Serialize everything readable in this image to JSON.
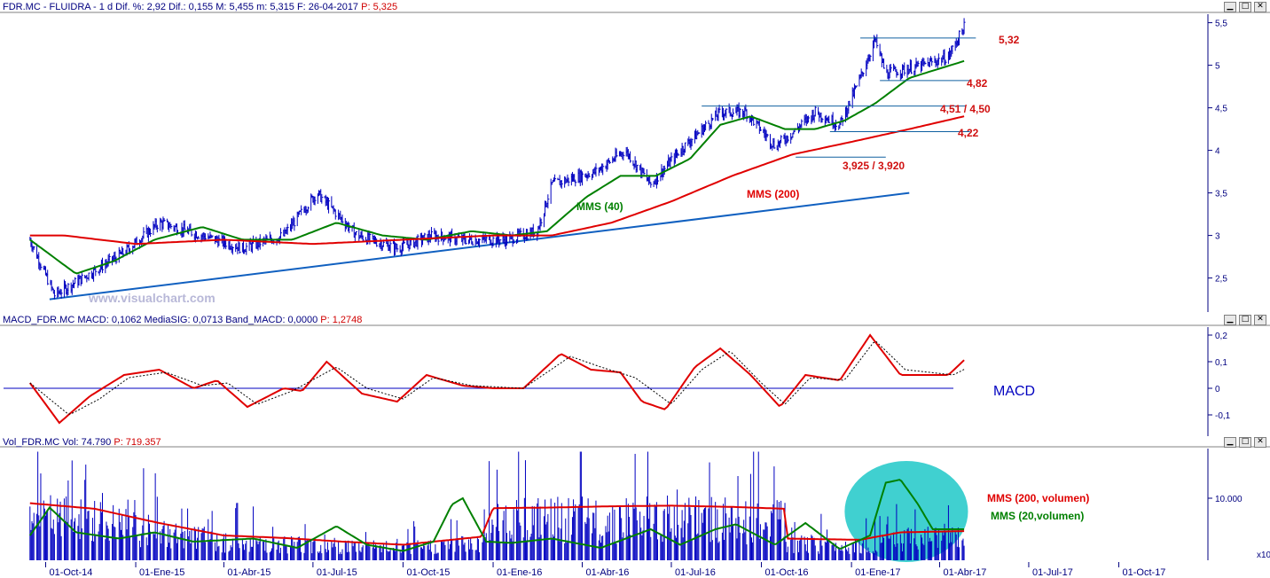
{
  "panels": {
    "price": {
      "header": {
        "text": "FDR.MC - FLUIDRA - 1 d Dif. %: 2,92 Dif.: 0,155 M: 5,455 m: 5,315 F: 26-04-2017",
        "p_value": "P: 5,325"
      }
    },
    "macd": {
      "header": {
        "text": "MACD_FDR.MC MACD: 0,1062 MediaSIG: 0,0713 Band_MACD: 0,0000",
        "p_value": "P: 1,2748"
      }
    },
    "volume": {
      "header": {
        "text": "Vol_FDR.MC Vol: 74.790",
        "p_value": "P: 719.357"
      }
    }
  },
  "window_buttons": {
    "minimize": "▁",
    "restore": "□",
    "close": "✕"
  },
  "watermark": "www.visualchart.com",
  "chart_data": [
    {
      "type": "candlestick",
      "title": "FDR.MC - FLUIDRA - 1 d",
      "ylim": [
        2.1,
        5.6
      ],
      "yticks": [
        "2,5",
        "3",
        "3,5",
        "4",
        "4,5",
        "5",
        "5,5"
      ],
      "ytick_values": [
        2.5,
        3,
        3.5,
        4,
        4.5,
        5,
        5.5
      ],
      "xticks": [
        "01-Oct-14",
        "01-Ene-15",
        "01-Abr-15",
        "01-Jul-15",
        "01-Oct-15",
        "01-Ene-16",
        "01-Abr-16",
        "01-Jul-16",
        "01-Oct-16",
        "01-Ene-17",
        "01-Abr-17",
        "01-Jul-17",
        "01-Oct-17"
      ],
      "close_keypoints": [
        [
          "2014-09-15",
          2.95
        ],
        [
          "2014-10-10",
          2.3
        ],
        [
          "2014-11-15",
          2.55
        ],
        [
          "2014-12-20",
          2.8
        ],
        [
          "2015-01-25",
          3.15
        ],
        [
          "2015-03-10",
          3.0
        ],
        [
          "2015-04-20",
          2.85
        ],
        [
          "2015-06-01",
          3.0
        ],
        [
          "2015-07-05",
          3.5
        ],
        [
          "2015-08-15",
          3.0
        ],
        [
          "2015-09-25",
          2.85
        ],
        [
          "2015-11-01",
          3.0
        ],
        [
          "2015-12-01",
          2.95
        ],
        [
          "2016-01-15",
          2.95
        ],
        [
          "2016-02-15",
          3.05
        ],
        [
          "2016-03-01",
          3.6
        ],
        [
          "2016-04-15",
          3.75
        ],
        [
          "2016-05-15",
          4.0
        ],
        [
          "2016-06-10",
          3.6
        ],
        [
          "2016-07-10",
          4.0
        ],
        [
          "2016-08-20",
          4.45
        ],
        [
          "2016-09-15",
          4.45
        ],
        [
          "2016-10-15",
          4.05
        ],
        [
          "2016-11-01",
          4.2
        ],
        [
          "2016-11-25",
          4.45
        ],
        [
          "2016-12-20",
          4.3
        ],
        [
          "2017-01-10",
          4.85
        ],
        [
          "2017-01-25",
          5.3
        ],
        [
          "2017-02-05",
          4.9
        ],
        [
          "2017-03-15",
          5.0
        ],
        [
          "2017-04-10",
          5.1
        ],
        [
          "2017-04-26",
          5.45
        ]
      ],
      "lines": [
        {
          "name": "MMS (40)",
          "color": "#008000",
          "keypoints": [
            [
              "2014-09-15",
              2.95
            ],
            [
              "2014-11-01",
              2.55
            ],
            [
              "2014-12-10",
              2.7
            ],
            [
              "2015-01-20",
              2.95
            ],
            [
              "2015-03-10",
              3.1
            ],
            [
              "2015-04-20",
              2.95
            ],
            [
              "2015-06-10",
              2.95
            ],
            [
              "2015-07-25",
              3.15
            ],
            [
              "2015-09-10",
              3.0
            ],
            [
              "2015-10-25",
              2.95
            ],
            [
              "2015-12-10",
              3.05
            ],
            [
              "2016-01-20",
              3.0
            ],
            [
              "2016-02-25",
              3.05
            ],
            [
              "2016-04-05",
              3.45
            ],
            [
              "2016-05-10",
              3.7
            ],
            [
              "2016-06-15",
              3.7
            ],
            [
              "2016-07-20",
              3.9
            ],
            [
              "2016-08-20",
              4.3
            ],
            [
              "2016-09-20",
              4.4
            ],
            [
              "2016-10-25",
              4.25
            ],
            [
              "2016-11-25",
              4.25
            ],
            [
              "2016-12-25",
              4.35
            ],
            [
              "2017-01-25",
              4.55
            ],
            [
              "2017-03-01",
              4.85
            ],
            [
              "2017-04-26",
              5.05
            ]
          ]
        },
        {
          "name": "MMS (200)",
          "color": "#e00000",
          "keypoints": [
            [
              "2014-09-15",
              3.0
            ],
            [
              "2014-10-20",
              3.0
            ],
            [
              "2015-01-01",
              2.9
            ],
            [
              "2015-04-01",
              2.95
            ],
            [
              "2015-07-01",
              2.9
            ],
            [
              "2015-10-01",
              2.95
            ],
            [
              "2016-01-01",
              3.0
            ],
            [
              "2016-03-01",
              3.0
            ],
            [
              "2016-05-01",
              3.15
            ],
            [
              "2016-07-01",
              3.4
            ],
            [
              "2016-09-01",
              3.7
            ],
            [
              "2016-11-01",
              3.95
            ],
            [
              "2017-01-01",
              4.1
            ],
            [
              "2017-03-01",
              4.25
            ],
            [
              "2017-04-26",
              4.4
            ]
          ]
        }
      ],
      "trendline": {
        "from": [
          "2014-10-05",
          2.25
        ],
        "to": [
          "2017-03-01",
          3.5
        ]
      },
      "levels": [
        {
          "label": "5,32",
          "value": 5.32,
          "from": "2017-01-10",
          "to": "2017-05-08"
        },
        {
          "label": "4,82",
          "value": 4.82,
          "from": "2017-01-30",
          "to": "2017-05-02"
        },
        {
          "label": "4,51 / 4,50",
          "value": 4.52,
          "from": "2016-08-01",
          "to": "2017-04-28"
        },
        {
          "label": "4,22",
          "value": 4.22,
          "from": "2016-12-10",
          "to": "2017-05-02"
        },
        {
          "label": "3,925 / 3,920",
          "value": 3.92,
          "from": "2016-11-05",
          "to": "2017-02-05"
        }
      ],
      "annotations": [
        "MMS (40)",
        "MMS (200)"
      ]
    },
    {
      "type": "line",
      "title": "MACD",
      "ylim": [
        -0.18,
        0.23
      ],
      "yticks": [
        "-0,1",
        "0",
        "0,1",
        "0,2"
      ],
      "ytick_values": [
        -0.1,
        0,
        0.1,
        0.2
      ],
      "series": [
        {
          "name": "MACD",
          "color": "#e00000",
          "keypoints": [
            [
              "2014-09-15",
              0.02
            ],
            [
              "2014-10-15",
              -0.13
            ],
            [
              "2014-11-15",
              -0.03
            ],
            [
              "2014-12-20",
              0.05
            ],
            [
              "2015-01-25",
              0.07
            ],
            [
              "2015-03-01",
              0.0
            ],
            [
              "2015-03-25",
              0.03
            ],
            [
              "2015-04-25",
              -0.07
            ],
            [
              "2015-06-01",
              0.0
            ],
            [
              "2015-06-20",
              -0.01
            ],
            [
              "2015-07-15",
              0.1
            ],
            [
              "2015-08-20",
              -0.02
            ],
            [
              "2015-09-25",
              -0.05
            ],
            [
              "2015-10-25",
              0.05
            ],
            [
              "2015-12-01",
              0.01
            ],
            [
              "2016-01-01",
              0.0
            ],
            [
              "2016-02-01",
              0.0
            ],
            [
              "2016-03-10",
              0.13
            ],
            [
              "2016-04-10",
              0.07
            ],
            [
              "2016-05-10",
              0.06
            ],
            [
              "2016-06-01",
              -0.05
            ],
            [
              "2016-06-25",
              -0.08
            ],
            [
              "2016-07-25",
              0.08
            ],
            [
              "2016-08-20",
              0.15
            ],
            [
              "2016-09-20",
              0.05
            ],
            [
              "2016-10-20",
              -0.07
            ],
            [
              "2016-11-15",
              0.05
            ],
            [
              "2016-12-20",
              0.03
            ],
            [
              "2017-01-20",
              0.2
            ],
            [
              "2017-02-20",
              0.05
            ],
            [
              "2017-04-10",
              0.05
            ],
            [
              "2017-04-26",
              0.106
            ]
          ]
        },
        {
          "name": "MediaSIG",
          "color": "#000000",
          "keypoints": [
            [
              "2014-09-15",
              0.02
            ],
            [
              "2014-10-25",
              -0.1
            ],
            [
              "2014-11-25",
              -0.04
            ],
            [
              "2014-12-25",
              0.04
            ],
            [
              "2015-02-01",
              0.06
            ],
            [
              "2015-03-10",
              0.01
            ],
            [
              "2015-04-05",
              0.02
            ],
            [
              "2015-05-05",
              -0.06
            ],
            [
              "2015-06-10",
              -0.01
            ],
            [
              "2015-07-25",
              0.08
            ],
            [
              "2015-08-25",
              0.0
            ],
            [
              "2015-10-01",
              -0.04
            ],
            [
              "2015-11-01",
              0.04
            ],
            [
              "2015-12-10",
              0.01
            ],
            [
              "2016-02-01",
              0.0
            ],
            [
              "2016-03-20",
              0.12
            ],
            [
              "2016-04-20",
              0.08
            ],
            [
              "2016-05-25",
              0.04
            ],
            [
              "2016-07-01",
              -0.06
            ],
            [
              "2016-08-01",
              0.07
            ],
            [
              "2016-08-30",
              0.14
            ],
            [
              "2016-10-01",
              0.02
            ],
            [
              "2016-10-25",
              -0.06
            ],
            [
              "2016-11-20",
              0.04
            ],
            [
              "2016-12-25",
              0.03
            ],
            [
              "2017-01-25",
              0.18
            ],
            [
              "2017-02-25",
              0.07
            ],
            [
              "2017-04-15",
              0.05
            ],
            [
              "2017-04-26",
              0.071
            ]
          ]
        }
      ],
      "zero_line": true,
      "annotations": [
        "MACD"
      ]
    },
    {
      "type": "bar",
      "title": "Vol_FDR.MC",
      "ylim": [
        0,
        18000
      ],
      "yticks": [
        "10.000"
      ],
      "ytick_values": [
        10000
      ],
      "unit_note": "x10",
      "lines": [
        {
          "name": "MMS (200, volumen)",
          "color": "#e00000",
          "keypoints": [
            [
              "2014-09-15",
              9200
            ],
            [
              "2014-11-20",
              8300
            ],
            [
              "2015-01-25",
              6000
            ],
            [
              "2015-04-01",
              4000
            ],
            [
              "2015-06-01",
              3600
            ],
            [
              "2015-08-01",
              3000
            ],
            [
              "2015-10-01",
              2500
            ],
            [
              "2015-12-20",
              3800
            ],
            [
              "2016-01-01",
              8400
            ],
            [
              "2016-03-01",
              8500
            ],
            [
              "2016-05-01",
              8700
            ],
            [
              "2016-07-01",
              8800
            ],
            [
              "2016-09-01",
              8600
            ],
            [
              "2016-10-25",
              8300
            ],
            [
              "2016-10-27",
              3500
            ],
            [
              "2016-12-01",
              3400
            ],
            [
              "2017-01-10",
              3300
            ],
            [
              "2017-02-20",
              4500
            ],
            [
              "2017-04-26",
              4700
            ]
          ]
        },
        {
          "name": "MMS (20,volumen)",
          "color": "#008000",
          "keypoints": [
            [
              "2014-09-15",
              4000
            ],
            [
              "2014-10-05",
              8500
            ],
            [
              "2014-11-01",
              4500
            ],
            [
              "2014-12-15",
              3500
            ],
            [
              "2015-01-20",
              4500
            ],
            [
              "2015-03-01",
              3000
            ],
            [
              "2015-05-01",
              3500
            ],
            [
              "2015-06-15",
              2000
            ],
            [
              "2015-07-25",
              5500
            ],
            [
              "2015-08-25",
              2500
            ],
            [
              "2015-10-01",
              1500
            ],
            [
              "2015-11-01",
              3000
            ],
            [
              "2015-11-20",
              9000
            ],
            [
              "2015-12-01",
              10000
            ],
            [
              "2015-12-25",
              3000
            ],
            [
              "2016-01-20",
              2800
            ],
            [
              "2016-03-01",
              3500
            ],
            [
              "2016-04-20",
              2000
            ],
            [
              "2016-06-10",
              5000
            ],
            [
              "2016-07-10",
              2500
            ],
            [
              "2016-08-15",
              5000
            ],
            [
              "2016-09-05",
              5800
            ],
            [
              "2016-10-15",
              2500
            ],
            [
              "2016-11-15",
              6000
            ],
            [
              "2016-12-20",
              1800
            ],
            [
              "2017-01-20",
              4000
            ],
            [
              "2017-02-05",
              12500
            ],
            [
              "2017-02-20",
              13000
            ],
            [
              "2017-03-10",
              9000
            ],
            [
              "2017-03-25",
              5000
            ],
            [
              "2017-04-26",
              5000
            ]
          ]
        }
      ],
      "highlight": {
        "from": "2016-12-25",
        "to": "2017-04-30",
        "color": "#00c0c0"
      },
      "legend": [
        "MMS (200, volumen)",
        "MMS (20,volumen)"
      ]
    }
  ]
}
